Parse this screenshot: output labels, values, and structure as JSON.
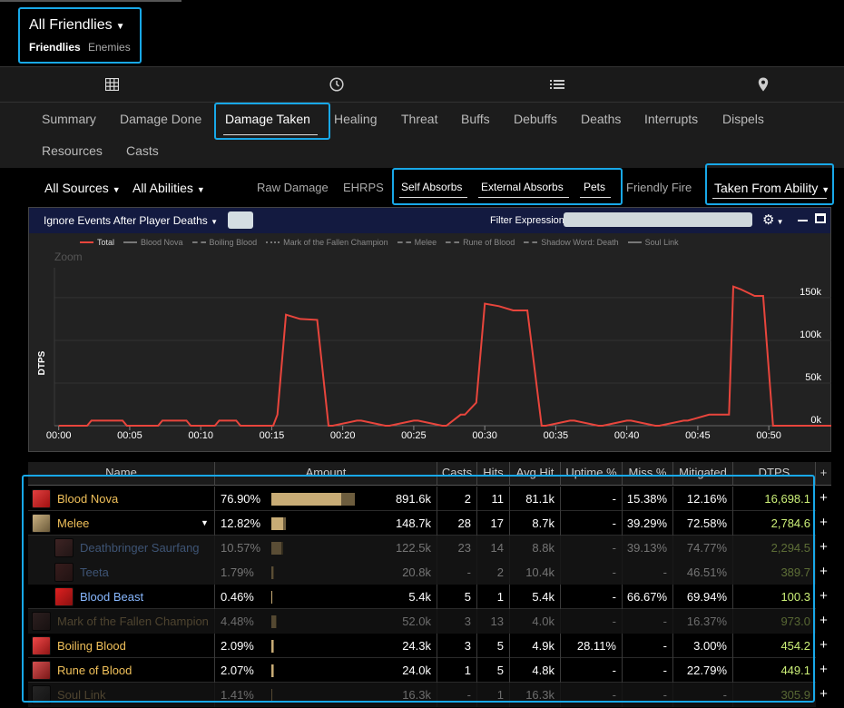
{
  "header": {
    "title": "All Friendlies",
    "tab_friendlies": "Friendlies",
    "tab_enemies": "Enemies"
  },
  "iconbar": {
    "icons": [
      "grid-icon",
      "clock-icon",
      "list-icon",
      "map-pin-icon"
    ]
  },
  "tabs": {
    "summary": "Summary",
    "damage_done": "Damage Done",
    "damage_taken": "Damage Taken",
    "healing": "Healing",
    "threat": "Threat",
    "buffs": "Buffs",
    "debuffs": "Debuffs",
    "deaths": "Deaths",
    "interrupts": "Interrupts",
    "dispels": "Dispels",
    "resources": "Resources",
    "casts": "Casts"
  },
  "filters": {
    "all_sources": "All Sources",
    "all_abilities": "All Abilities",
    "raw_damage": "Raw Damage",
    "ehrps": "EHRPS",
    "self_absorbs": "Self Absorbs",
    "external_absorbs": "External Absorbs",
    "pets": "Pets",
    "friendly_fire": "Friendly Fire",
    "taken_from_ability": "Taken From Ability"
  },
  "chart_toolbar": {
    "ignore_events": "Ignore Events After Player Deaths",
    "filter_label": "Filter Expression:",
    "filter_value": ""
  },
  "colors": {
    "accent_highlight": "#18a8e8",
    "total_line": "#e8453c",
    "dtps_green": "#ccf078",
    "friendly_name": "#f0c05a",
    "pet_name": "#88b8ff",
    "bar_primary": "#c8ac76",
    "bar_secondary": "#6d5d3e"
  },
  "chart_data": {
    "type": "line",
    "ylabel": "DTPS",
    "zoom_label": "Zoom",
    "y_ticks": [
      "150k",
      "100k",
      "50k",
      "0k"
    ],
    "y_tick_values": [
      150000,
      100000,
      50000,
      0
    ],
    "ylim": [
      0,
      185000
    ],
    "x_ticks": [
      "00:00",
      "00:05",
      "00:10",
      "00:15",
      "00:20",
      "00:25",
      "00:30",
      "00:35",
      "00:40",
      "00:45",
      "00:50"
    ],
    "x_tick_seconds": [
      0,
      5,
      10,
      15,
      20,
      25,
      30,
      35,
      40,
      45,
      50
    ],
    "xlim": [
      -0.3,
      54.4
    ],
    "legend": [
      "Total",
      "Blood Nova",
      "Boiling Blood",
      "Mark of the Fallen Champion",
      "Melee",
      "Rune of Blood",
      "Shadow Word: Death",
      "Soul Link"
    ],
    "series": [
      {
        "name": "Total",
        "x": [
          0,
          2,
          2.3,
          4.5,
          4.8,
          7,
          7.3,
          9,
          9.3,
          11,
          11.3,
          12.5,
          12.8,
          15.1,
          15.4,
          16,
          17,
          18.2,
          19,
          19.3,
          21,
          21.3,
          23,
          23.3,
          25,
          25.3,
          27,
          27.3,
          28.3,
          28.6,
          29.4,
          30,
          31,
          32,
          33,
          34,
          34.3,
          36,
          36.3,
          38,
          38.3,
          40,
          40.3,
          42,
          42.3,
          44,
          44.3,
          45.8,
          47.2,
          47.5,
          48,
          49,
          49.6,
          50.3,
          52,
          54.4
        ],
        "y": [
          0,
          0,
          6000,
          6000,
          0,
          0,
          6000,
          6000,
          0,
          0,
          6000,
          6000,
          0,
          0,
          13000,
          130000,
          125000,
          124000,
          0,
          0,
          6000,
          6000,
          0,
          0,
          6000,
          6000,
          0,
          0,
          13000,
          13000,
          27000,
          143000,
          140000,
          135000,
          135000,
          0,
          0,
          6000,
          6000,
          0,
          0,
          6000,
          6000,
          0,
          0,
          6000,
          6000,
          13000,
          13000,
          163000,
          160000,
          152000,
          152000,
          0,
          0,
          0
        ]
      }
    ]
  },
  "table": {
    "columns": [
      "Name",
      "Amount",
      "Casts",
      "Hits",
      "Avg Hit",
      "Uptime %",
      "Miss %",
      "Mitigated",
      "DTPS",
      "+"
    ],
    "rows": [
      {
        "name": "Blood Nova",
        "pct": "76.90%",
        "bar_fraction": 0.769,
        "amount": "891.6k",
        "casts": "2",
        "hits": "11",
        "avg_hit": "81.1k",
        "uptime": "-",
        "miss": "15.38%",
        "mitigated": "12.16%",
        "dtps": "16,698.1",
        "icon": "blood-nova-icon",
        "kind": "main"
      },
      {
        "name": "Melee",
        "pct": "12.82%",
        "bar_fraction": 0.128,
        "amount": "148.7k",
        "casts": "28",
        "hits": "17",
        "avg_hit": "8.7k",
        "uptime": "-",
        "miss": "39.29%",
        "mitigated": "72.58%",
        "dtps": "2,784.6",
        "icon": "melee-icon",
        "kind": "main",
        "expanded": true
      },
      {
        "name": "Deathbringer Saurfang",
        "pct": "10.57%",
        "bar_fraction": 0.106,
        "amount": "122.5k",
        "casts": "23",
        "hits": "14",
        "avg_hit": "8.8k",
        "uptime": "-",
        "miss": "39.13%",
        "mitigated": "74.77%",
        "dtps": "2,294.5",
        "icon": "saurfang-icon",
        "kind": "dim-sub"
      },
      {
        "name": "Teeta",
        "pct": "1.79%",
        "bar_fraction": 0.018,
        "amount": "20.8k",
        "casts": "-",
        "hits": "2",
        "avg_hit": "10.4k",
        "uptime": "-",
        "miss": "-",
        "mitigated": "46.51%",
        "dtps": "389.7",
        "icon": "teeta-icon",
        "kind": "dim-sub"
      },
      {
        "name": "Blood Beast",
        "pct": "0.46%",
        "bar_fraction": 0.005,
        "amount": "5.4k",
        "casts": "5",
        "hits": "1",
        "avg_hit": "5.4k",
        "uptime": "-",
        "miss": "66.67%",
        "mitigated": "69.94%",
        "dtps": "100.3",
        "icon": "blood-beast-icon",
        "kind": "sub"
      },
      {
        "name": "Mark of the Fallen Champion",
        "pct": "4.48%",
        "bar_fraction": 0.045,
        "amount": "52.0k",
        "casts": "3",
        "hits": "13",
        "avg_hit": "4.0k",
        "uptime": "-",
        "miss": "-",
        "mitigated": "16.37%",
        "dtps": "973.0",
        "icon": "mark-icon",
        "kind": "dim"
      },
      {
        "name": "Boiling Blood",
        "pct": "2.09%",
        "bar_fraction": 0.021,
        "amount": "24.3k",
        "casts": "3",
        "hits": "5",
        "avg_hit": "4.9k",
        "uptime": "28.11%",
        "miss": "-",
        "mitigated": "3.00%",
        "dtps": "454.2",
        "icon": "boiling-blood-icon",
        "kind": "main"
      },
      {
        "name": "Rune of Blood",
        "pct": "2.07%",
        "bar_fraction": 0.021,
        "amount": "24.0k",
        "casts": "1",
        "hits": "5",
        "avg_hit": "4.8k",
        "uptime": "-",
        "miss": "-",
        "mitigated": "22.79%",
        "dtps": "449.1",
        "icon": "rune-of-blood-icon",
        "kind": "main"
      },
      {
        "name": "Soul Link",
        "pct": "1.41%",
        "bar_fraction": 0.014,
        "amount": "16.3k",
        "casts": "-",
        "hits": "1",
        "avg_hit": "16.3k",
        "uptime": "-",
        "miss": "-",
        "mitigated": "-",
        "dtps": "305.9",
        "icon": "soul-link-icon",
        "kind": "dim"
      }
    ]
  }
}
